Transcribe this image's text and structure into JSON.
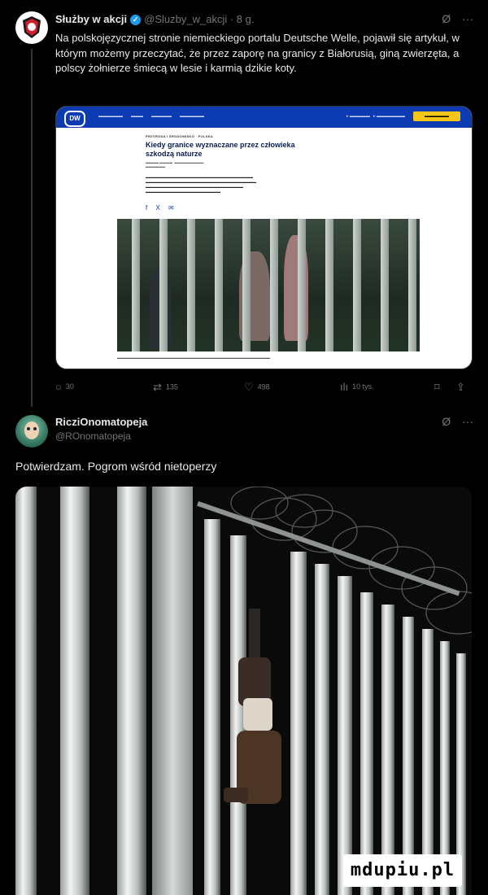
{
  "tweet1": {
    "author_name": "Służby w akcji",
    "handle_time": "@Sluzby_w_akcji · 8 g.",
    "text": "Na polskojęzycznej stronie niemieckiego portalu Deutsche Welle, pojawił się artykuł, w którym możemy przeczytać, że przez zaporę na granicy z Białorusią, giną zwierzęta, a polscy żołnierze śmiecą w lesie i karmią dzikie koty.",
    "card": {
      "logo": "DW",
      "kicker": "PRZYRODA I ŚRODOWISKO · POLSKA",
      "headline": "Kiedy granice wyznaczane przez człowieka szkodzą naturze"
    },
    "actions": {
      "replies": "30",
      "reposts": "135",
      "likes": "498",
      "views": "10 tys."
    },
    "accent_color": "#1d9bf0"
  },
  "tweet2": {
    "author_name": "RicziOnomatopeja",
    "handle": "@ROnomatopeja",
    "text": "Potwierdzam. Pogrom wśród nietoperzy"
  },
  "watermark": "mdupiu.pl",
  "icons": {
    "grok": "Ø",
    "more": "···",
    "reply": "○",
    "repost": "⇄",
    "like": "♡",
    "views": "ılı",
    "bookmark": "⌑",
    "share": "⇪"
  }
}
